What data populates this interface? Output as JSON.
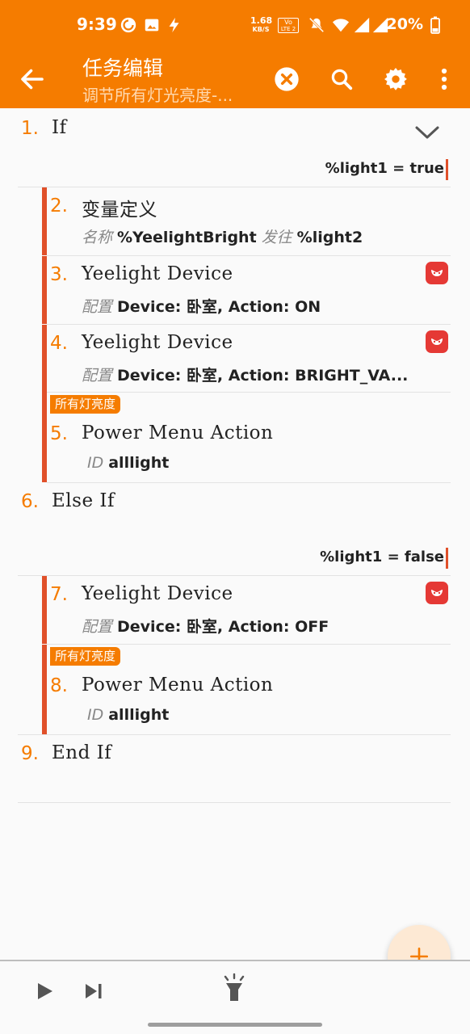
{
  "status": {
    "time": "9:39",
    "net_speed_value": "1.68",
    "net_speed_unit": "KB/S",
    "volte_top": "Vo",
    "volte_bottom": "LTE 2",
    "battery": "20%"
  },
  "appbar": {
    "title": "任务编辑",
    "subtitle": "调节所有灯光亮度-..."
  },
  "actions": [
    {
      "num": "1.",
      "label": "If",
      "condition": "%light1 = true"
    },
    {
      "num": "2.",
      "label": "变量定义",
      "key": "名称",
      "value1": "%YeelightBright",
      "kw": "发往",
      "value2": "%light2"
    },
    {
      "num": "3.",
      "label": "Yeelight Device",
      "key": "配置",
      "value": "Device: 卧室, Action: ON"
    },
    {
      "num": "4.",
      "label": "Yeelight Device",
      "key": "配置",
      "value": "Device: 卧室, Action: BRIGHT_VA..."
    },
    {
      "num": "5.",
      "label": "Power Menu Action",
      "key": "ID",
      "value": "alllight",
      "tag": "所有灯亮度"
    },
    {
      "num": "6.",
      "label": "Else If",
      "condition": "%light1 = false"
    },
    {
      "num": "7.",
      "label": "Yeelight Device",
      "key": "配置",
      "value": "Device: 卧室, Action: OFF"
    },
    {
      "num": "8.",
      "label": "Power Menu Action",
      "key": "ID",
      "value": "alllight",
      "tag": "所有灯亮度"
    },
    {
      "num": "9.",
      "label": "End If"
    }
  ],
  "colors": {
    "accent": "#f57c00",
    "block_bar": "#e0502a",
    "yeelight_icon": "#e53935"
  },
  "icons": {
    "back": "arrow-left-icon",
    "clear": "close-circle-icon",
    "search": "search-icon",
    "settings": "gear-icon",
    "more": "more-vertical-icon",
    "collapse": "chevron-down-icon",
    "add": "plus-icon",
    "play": "play-icon",
    "step": "step-forward-icon",
    "flashlight": "flashlight-icon"
  }
}
